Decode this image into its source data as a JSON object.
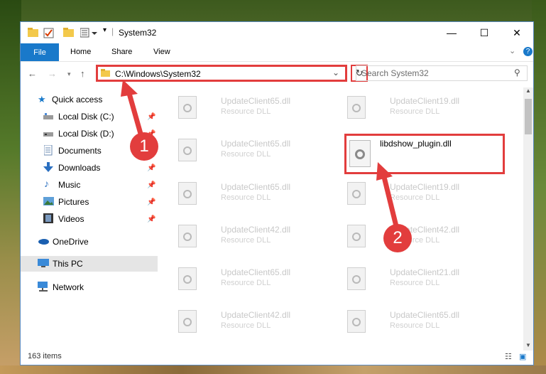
{
  "window": {
    "title": "System32",
    "controls": {
      "minimize": "—",
      "maximize": "☐",
      "close": "✕"
    }
  },
  "ribbon": {
    "file_label": "File",
    "tabs": [
      {
        "label": "Home"
      },
      {
        "label": "Share"
      },
      {
        "label": "View"
      }
    ]
  },
  "address": {
    "path": "C:\\Windows\\System32",
    "search_placeholder": "Search System32"
  },
  "nav": {
    "items": [
      {
        "label": "Quick access",
        "icon": "star-icon"
      },
      {
        "label": "Local Disk (C:)",
        "icon": "drive-icon"
      },
      {
        "label": "Local Disk (D:)",
        "icon": "drive-icon"
      },
      {
        "label": "Documents",
        "icon": "documents-icon"
      },
      {
        "label": "Downloads",
        "icon": "download-icon"
      },
      {
        "label": "Music",
        "icon": "music-icon"
      },
      {
        "label": "Pictures",
        "icon": "pictures-icon"
      },
      {
        "label": "Videos",
        "icon": "videos-icon"
      },
      {
        "label": "OneDrive",
        "icon": "cloud-icon"
      },
      {
        "label": "This PC",
        "icon": "computer-icon"
      },
      {
        "label": "Network",
        "icon": "network-icon"
      }
    ]
  },
  "files": [
    {
      "name": "UpdateClient65.dll",
      "type": "Resource DLL"
    },
    {
      "name": "UpdateClient19.dll",
      "type": "Resource DLL"
    },
    {
      "name": "UpdateClient65.dll",
      "type": "Resource DLL"
    },
    {
      "name": "UpdateClient65.dll",
      "type": "Resource DLL"
    },
    {
      "name": "UpdateClient19.dll",
      "type": "Resource DLL"
    },
    {
      "name": "UpdateClient42.dll",
      "type": "Resource DLL"
    },
    {
      "name": "UpdateClient42.dll",
      "type": "Resource DLL"
    },
    {
      "name": "UpdateClient65.dll",
      "type": "Resource DLL"
    },
    {
      "name": "UpdateClient21.dll",
      "type": "Resource DLL"
    },
    {
      "name": "UpdateClient42.dll",
      "type": "Resource DLL"
    },
    {
      "name": "UpdateClient65.dll",
      "type": "Resource DLL"
    }
  ],
  "highlighted_file": {
    "name": "libdshow_plugin.dll"
  },
  "status": {
    "items_count": "163 items"
  },
  "markers": {
    "one": "1",
    "two": "2"
  },
  "colors": {
    "accent": "#1979ca",
    "highlight_red": "#e23d3d"
  }
}
